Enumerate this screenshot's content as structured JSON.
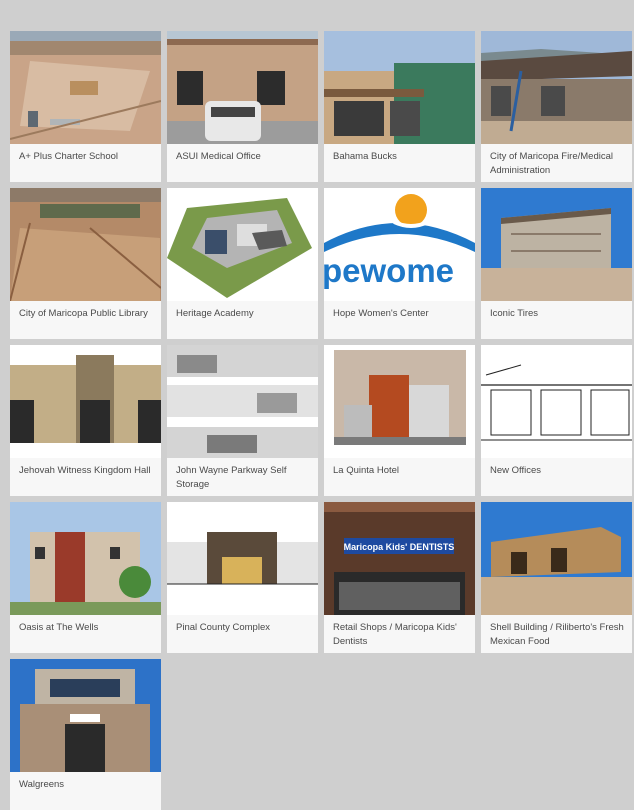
{
  "projects": [
    {
      "name": "A+ Plus Charter School",
      "image": "aerial-construction-site-icon"
    },
    {
      "name": "ASUI Medical Office",
      "image": "medical-office-building-icon"
    },
    {
      "name": "Bahama Bucks",
      "image": "storefront-icon"
    },
    {
      "name": "City of Maricopa Fire/Medical Administration",
      "image": "building-frame-construction-icon"
    },
    {
      "name": "City of Maricopa Public Library",
      "image": "aerial-desert-site-icon"
    },
    {
      "name": "Heritage Academy",
      "image": "school-rendering-icon"
    },
    {
      "name": "Hope Women's Center",
      "image": "hope-womens-center-logo",
      "logo_text": "pewome"
    },
    {
      "name": "Iconic Tires",
      "image": "building-frame-construction-icon"
    },
    {
      "name": "Jehovah Witness Kingdom Hall",
      "image": "hall-elevation-icon"
    },
    {
      "name": "John Wayne Parkway Self Storage",
      "image": "storage-elevation-drawing-icon"
    },
    {
      "name": "La Quinta Hotel",
      "image": "hotel-rendering-icon"
    },
    {
      "name": "New Offices",
      "image": "office-sketch-icon"
    },
    {
      "name": "Oasis at The Wells",
      "image": "apartment-rendering-icon"
    },
    {
      "name": "Pinal County Complex",
      "image": "county-complex-elevation-icon"
    },
    {
      "name": "Retail Shops / Maricopa Kids' Dentists",
      "image": "dentist-storefront-icon",
      "sign_text": "Maricopa Kids' DENTISTS"
    },
    {
      "name": "Shell Building / Riliberto's Fresh Mexican Food",
      "image": "shell-building-construction-icon"
    },
    {
      "name": "Walgreens",
      "image": "walgreens-building-icon"
    }
  ]
}
